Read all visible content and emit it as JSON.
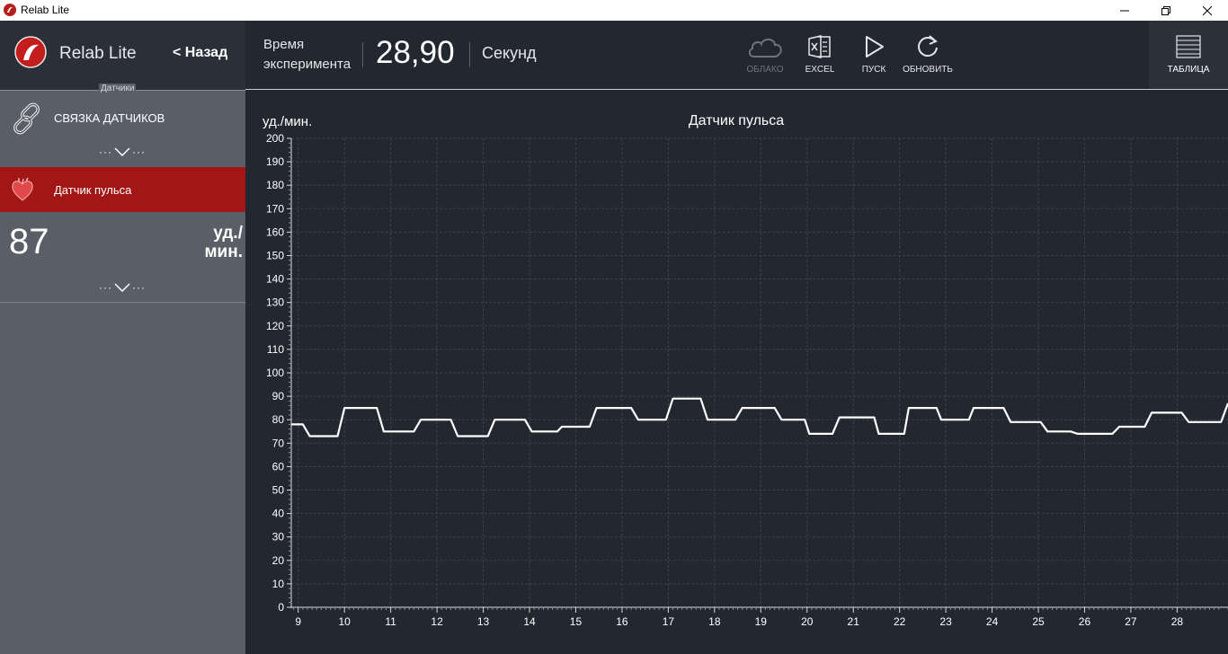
{
  "window": {
    "title": "Relab Lite",
    "controls": [
      "minimize-icon",
      "maximize-icon",
      "close-icon"
    ]
  },
  "sidebar": {
    "app_name": "Relab Lite",
    "back_label": "< Назад",
    "section_label": "Датчики",
    "link_item": {
      "label": "СВЯЗКА ДАТЧИКОВ",
      "icon": "chain-link-icon"
    },
    "sensor": {
      "label": "Датчик пульса",
      "icon": "heart-icon",
      "value": "87",
      "unit_line1": "уд./",
      "unit_line2": "мин."
    },
    "expander_label": "···",
    "colors": {
      "active": "#a31616",
      "panel": "#5a5f67",
      "header": "#2b3038"
    }
  },
  "toolbar": {
    "time_label_line1": "Время",
    "time_label_line2": "эксперимента",
    "time_value": "28,90",
    "time_unit": "Секунд",
    "buttons": [
      {
        "label": "ОБЛАКО",
        "icon": "cloud-icon",
        "enabled": false
      },
      {
        "label": "EXCEL",
        "icon": "excel-icon",
        "enabled": true
      },
      {
        "label": "ПУСК",
        "icon": "play-icon",
        "enabled": true
      },
      {
        "label": "ОБНОВИТЬ",
        "icon": "refresh-icon",
        "enabled": true
      }
    ],
    "table_label": "ТАБЛИЦА",
    "table_icon": "table-icon"
  },
  "chart_data": {
    "type": "line",
    "title": "Датчик пульса",
    "ylabel": "уд./мин.",
    "xlabel": "",
    "xlim": [
      8.85,
      29.1
    ],
    "ylim": [
      0,
      200
    ],
    "x_ticks": [
      9,
      10,
      11,
      12,
      13,
      14,
      15,
      16,
      17,
      18,
      19,
      20,
      21,
      22,
      23,
      24,
      25,
      26,
      27,
      28
    ],
    "y_ticks": [
      0,
      10,
      20,
      30,
      40,
      50,
      60,
      70,
      80,
      90,
      100,
      110,
      120,
      130,
      140,
      150,
      160,
      170,
      180,
      190,
      200
    ],
    "grid": true,
    "line_color": "#ffffff",
    "series": [
      {
        "x": [
          8.85,
          9.1,
          9.25,
          9.85,
          10.0,
          10.7,
          10.85,
          11.5,
          11.65,
          12.3,
          12.45,
          13.1,
          13.25,
          13.9,
          14.05,
          14.6,
          14.7,
          15.3,
          15.45,
          16.2,
          16.35,
          16.95,
          17.1,
          17.7,
          17.85,
          18.45,
          18.6,
          19.3,
          19.45,
          19.95,
          20.05,
          20.55,
          20.7,
          21.45,
          21.55,
          22.1,
          22.2,
          22.8,
          22.9,
          23.5,
          23.6,
          24.25,
          24.4,
          25.05,
          25.2,
          25.7,
          25.85,
          26.6,
          26.75,
          27.3,
          27.45,
          28.1,
          28.25,
          28.95,
          29.1
        ],
        "values": [
          78,
          78,
          73,
          73,
          85,
          85,
          75,
          75,
          80,
          80,
          73,
          73,
          80,
          80,
          75,
          75,
          77,
          77,
          85,
          85,
          80,
          80,
          89,
          89,
          80,
          80,
          85,
          85,
          80,
          80,
          74,
          74,
          81,
          81,
          74,
          74,
          85,
          85,
          80,
          80,
          85,
          85,
          79,
          79,
          75,
          75,
          74,
          74,
          77,
          77,
          83,
          83,
          79,
          79,
          87
        ]
      }
    ]
  }
}
